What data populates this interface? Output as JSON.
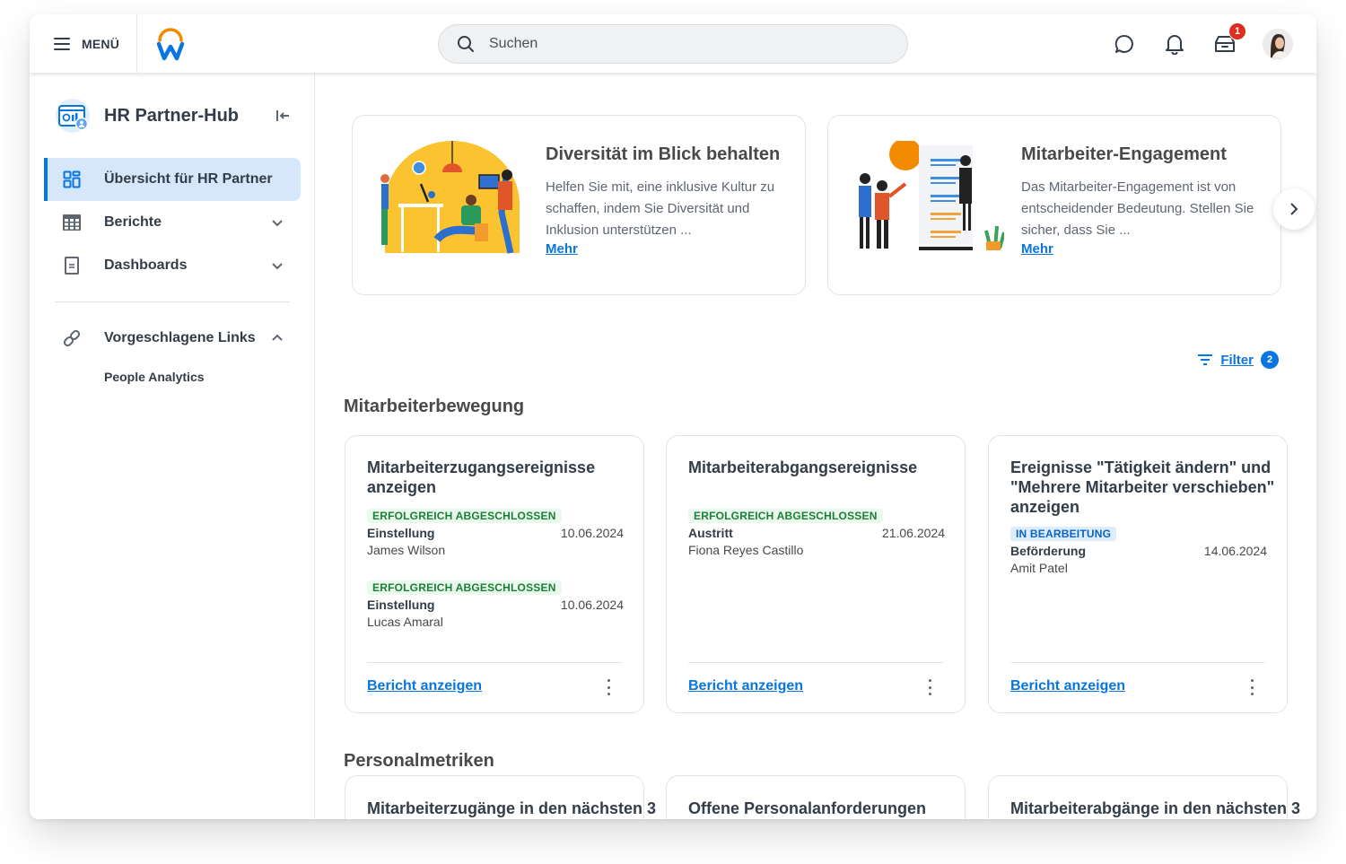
{
  "topbar": {
    "menu_label": "MENÜ",
    "search_placeholder": "Suchen",
    "icons": [
      "chat-icon",
      "bell-icon",
      "inbox-icon"
    ],
    "inbox_badge": "1",
    "colors": {
      "brand_blue": "#0875e1",
      "brand_orange": "#f38b00",
      "badge_red": "#de2e21"
    }
  },
  "sidebar": {
    "hub_title": "HR Partner-Hub",
    "items": [
      {
        "label": "Übersicht für HR Partner",
        "icon": "grid-icon",
        "active": true
      },
      {
        "label": "Berichte",
        "icon": "table-icon",
        "expanded": false
      },
      {
        "label": "Dashboards",
        "icon": "document-icon",
        "expanded": false
      }
    ],
    "suggested": {
      "label": "Vorgeschlagene Links",
      "icon": "link-icon",
      "expanded": true,
      "links": [
        "People Analytics"
      ]
    }
  },
  "hero": [
    {
      "title": "Diversität im Blick behalten",
      "description": "Helfen Sie mit, eine inklusive Kultur zu schaffen, indem Sie Diversität und Inklusion unterstützen ...",
      "more": "Mehr"
    },
    {
      "title": "Mitarbeiter-Engagement",
      "description": "Das Mitarbeiter-Engagement ist von entscheidender Bedeutung. Stellen Sie sicher, dass Sie ...",
      "more": "Mehr"
    }
  ],
  "filter": {
    "label": "Filter",
    "count": "2"
  },
  "movement": {
    "title": "Mitarbeiterbewegung",
    "cards": [
      {
        "title": "Mitarbeiterzugangsereignisse anzeigen",
        "events": [
          {
            "status": "ERFOLGREICH ABGESCHLOSSEN",
            "type": "Einstellung",
            "date": "10.06.2024",
            "name": "James Wilson"
          },
          {
            "status": "ERFOLGREICH ABGESCHLOSSEN",
            "type": "Einstellung",
            "date": "10.06.2024",
            "name": "Lucas Amaral"
          }
        ],
        "link": "Bericht anzeigen"
      },
      {
        "title": "Mitarbeiterabgangsereignisse",
        "events": [
          {
            "status": "ERFOLGREICH ABGESCHLOSSEN",
            "type": "Austritt",
            "date": "21.06.2024",
            "name": "Fiona Reyes Castillo"
          }
        ],
        "link": "Bericht anzeigen"
      },
      {
        "title": "Ereignisse \"Tätigkeit ändern\" und \"Mehrere Mitarbeiter verschieben\" anzeigen",
        "events": [
          {
            "status": "IN BEARBEITUNG",
            "type": "Beförderung",
            "date": "14.06.2024",
            "name": "Amit Patel"
          }
        ],
        "link": "Bericht anzeigen"
      }
    ]
  },
  "metrics": {
    "title": "Personalmetriken",
    "cards": [
      {
        "title": "Mitarbeiterzugänge in den nächsten 3"
      },
      {
        "title": "Offene Personalanforderungen"
      },
      {
        "title": "Mitarbeiterabgänge in den nächsten 3"
      }
    ]
  }
}
